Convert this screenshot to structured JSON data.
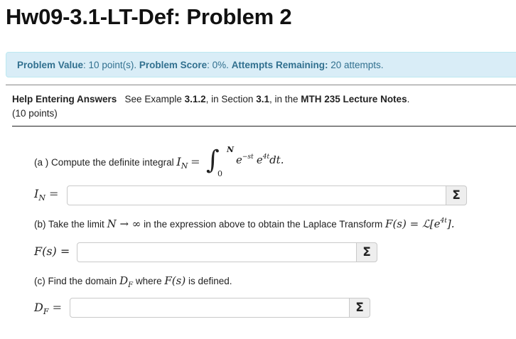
{
  "title": "Hw09-3.1-LT-Def: Problem 2",
  "status": {
    "problem_value_label": "Problem Value",
    "problem_value": ": 10 point(s).",
    "problem_score_label": "Problem Score",
    "problem_score": ": 0%.",
    "attempts_label": "Attempts Remaining:",
    "attempts": "20 attempts."
  },
  "help": {
    "link_label": "Help Entering Answers",
    "see_prefix": "See Example",
    "example": "3.1.2",
    "in_section": ", in Section",
    "section": "3.1",
    "in_the": ", in the",
    "notes": "MTH 235 Lecture Notes",
    "period": ".",
    "points": "(10 points)"
  },
  "part_a": {
    "text": "(a ) Compute the definite integral",
    "math_lhs": "I",
    "math_sub": "N",
    "eq": "=",
    "upper": "N",
    "lower": "0",
    "integrand_e1": "e",
    "exp1": "−st",
    "integrand_e2": "e",
    "exp2": "4t",
    "dt": "dt.",
    "answer_label": "I",
    "answer_sub": "N",
    "answer_eq": "=",
    "answer_value": ""
  },
  "part_b": {
    "text_prefix": "(b) Take the limit",
    "limit_expr": "N → ∞",
    "text_mid": "in the expression above to obtain the Laplace Transform",
    "transform_expr": "F(s) = ℒ[e",
    "transform_exp": "4t",
    "transform_close": "].",
    "answer_label": "F(s) =",
    "answer_value": ""
  },
  "part_c": {
    "text_prefix": "(c) Find the domain",
    "domain_sym": "D",
    "domain_sub": "F",
    "text_mid": "where",
    "func": "F(s)",
    "text_suffix": "is defined.",
    "answer_label": "D",
    "answer_sub": "F",
    "answer_eq": "=",
    "answer_value": ""
  },
  "equation_editor_icon": "Σ",
  "colors": {
    "alert_bg": "#d9edf7",
    "alert_text": "#31708f",
    "sigma_bg": "#eeeeee"
  }
}
